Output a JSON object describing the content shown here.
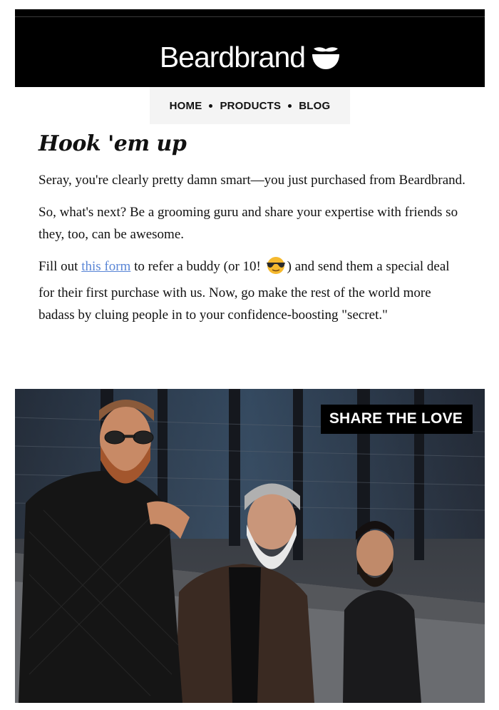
{
  "header": {
    "brand_name": "Beardbrand",
    "logo_icon": "beard-icon"
  },
  "nav": {
    "items": [
      {
        "label": "HOME"
      },
      {
        "label": "PRODUCTS"
      },
      {
        "label": "BLOG"
      }
    ]
  },
  "article": {
    "title": "Hook 'em up",
    "para1": "Seray, you're clearly pretty damn smart—you just purchased from Beardbrand.",
    "para2": "So, what's next? Be a grooming guru and share your expertise with friends so they, too, can be awesome.",
    "para3_before_link": "Fill out ",
    "para3_link": "this form",
    "para3_mid": " to refer a buddy (or 10! ",
    "para3_emoji": "sunglasses-emoji",
    "para3_after": ") and send them a special deal for their first purchase with us. Now, go make the rest of the world more badass by cluing people in to your confidence-boosting \"secret.\""
  },
  "hero": {
    "badge": "SHARE THE LOVE",
    "image_subject": "three-bearded-men-photo"
  },
  "colors": {
    "header_bg": "#000000",
    "nav_bg": "#f4f4f4",
    "link": "#5a86d6"
  }
}
